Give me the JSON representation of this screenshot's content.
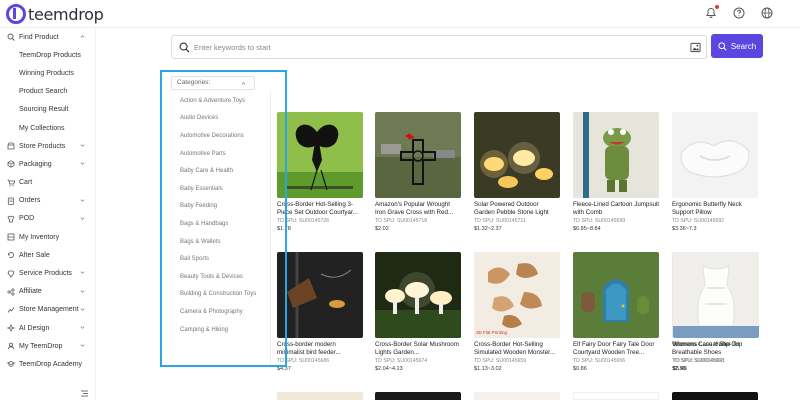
{
  "brand": {
    "name": "teemdrop"
  },
  "topbar": {
    "icons": [
      "bell-icon",
      "help-icon",
      "globe-icon"
    ]
  },
  "sidebar": {
    "items": [
      {
        "label": "Find Product",
        "icon": "search-icon",
        "expanded": true
      },
      {
        "label": "TeemDrop Products",
        "sub": true
      },
      {
        "label": "Winning Products",
        "sub": true
      },
      {
        "label": "Product Search",
        "sub": true
      },
      {
        "label": "Sourcing Result",
        "sub": true
      },
      {
        "label": "My Collections",
        "sub": true
      },
      {
        "label": "Store Products",
        "icon": "store-icon",
        "expandable": true
      },
      {
        "label": "Packaging",
        "icon": "package-icon",
        "expandable": true
      },
      {
        "label": "Cart",
        "icon": "cart-icon"
      },
      {
        "label": "Orders",
        "icon": "orders-icon",
        "expandable": true
      },
      {
        "label": "POD",
        "icon": "pod-icon",
        "expandable": true
      },
      {
        "label": "My Inventory",
        "icon": "inventory-icon"
      },
      {
        "label": "After Sale",
        "icon": "after-sale-icon"
      },
      {
        "label": "Service Products",
        "icon": "service-icon",
        "expandable": true
      },
      {
        "label": "Affiliate",
        "icon": "affiliate-icon",
        "expandable": true
      },
      {
        "label": "Store Management",
        "icon": "store-management-icon",
        "expandable": true
      },
      {
        "label": "AI Design",
        "icon": "ai-icon",
        "expandable": true
      },
      {
        "label": "My TeemDrop",
        "icon": "user-icon",
        "expandable": true
      },
      {
        "label": "TeemDrop Academy",
        "icon": "academy-icon"
      }
    ]
  },
  "search": {
    "placeholder": "Enter keywords to start",
    "value": "",
    "button_label": "Search"
  },
  "categories": {
    "trigger_label": "Categories:",
    "items": [
      "Action & Adventure Toys",
      "Audio Devices",
      "Automotive Decorations",
      "Automotive Parts",
      "Baby Care & Health",
      "Baby Essentials",
      "Baby Feeding",
      "Bags & Handbags",
      "Bags & Wallets",
      "Ball Sports",
      "Beauty Tools & Devices",
      "Building & Construction Toys",
      "Camera & Photography",
      "Camping & Hiking"
    ]
  },
  "products": [
    {
      "title": "Cross-Border Hot-Selling 3-Piece Set Outdoor Courtyar...",
      "spu": "TD SPU: SU00145726",
      "price": "$1.78",
      "image": "fairy-silhouette"
    },
    {
      "title": "Amazon's Popular Wrought Iron Grave Cross with Red...",
      "spu": "TD SPU: SU00145718",
      "price": "$2.02",
      "image": "grave-cross"
    },
    {
      "title": "Solar Powered Outdoor Garden Pebble Stone Light",
      "spu": "TD SPU: SU00145711",
      "price": "$1.32~2.37",
      "image": "pebble-lights"
    },
    {
      "title": "Fleece-Lined Cartoon Jumpsuit with Comb",
      "spu": "TD SPU: SU00145699",
      "price": "$6.85~8.84",
      "image": "frog-puppet"
    },
    {
      "title": "Ergonomic Butterfly Neck Support Pillow",
      "spu": "TD SPU: SU00145692",
      "price": "$3.36~7.3",
      "image": "pillow"
    },
    {
      "title": "Cross-border modern minimalist bird feeder...",
      "spu": "TD SPU: SU00145686",
      "price": "$4.37",
      "image": "bird-feeder"
    },
    {
      "title": "Cross-Border Solar Mushroom Lights Garden...",
      "spu": "TD SPU: SU00145674",
      "price": "$2.04~4.13",
      "image": "mushroom-lights"
    },
    {
      "title": "Cross-Border Hot-Selling Simulated Wooden Monster...",
      "spu": "TD SPU: SU00145659",
      "price": "$1.13~3.02",
      "image": "wooden-leaves"
    },
    {
      "title": "Elf Fairy Door Fairy Tale Door Courtyard Wooden Tree...",
      "spu": "TD SPU: SU00145656",
      "price": "$0.86",
      "image": "fairy-door"
    },
    {
      "title": "Womens Casual Slip-On Breathable Shoes",
      "spu": "TD SPU: SU00145653",
      "price": "$2.55",
      "image": "shoes"
    },
    {
      "title": "Womens Lace Halter Top",
      "spu": "TD SPU: SU00145641",
      "price": "$5.48",
      "image": "lace-top"
    }
  ],
  "image_badges": {
    "wooden_leaves": "3D Flat Printing"
  },
  "colors": {
    "accent": "#5b46e0",
    "highlight": "#2aa6e0"
  }
}
